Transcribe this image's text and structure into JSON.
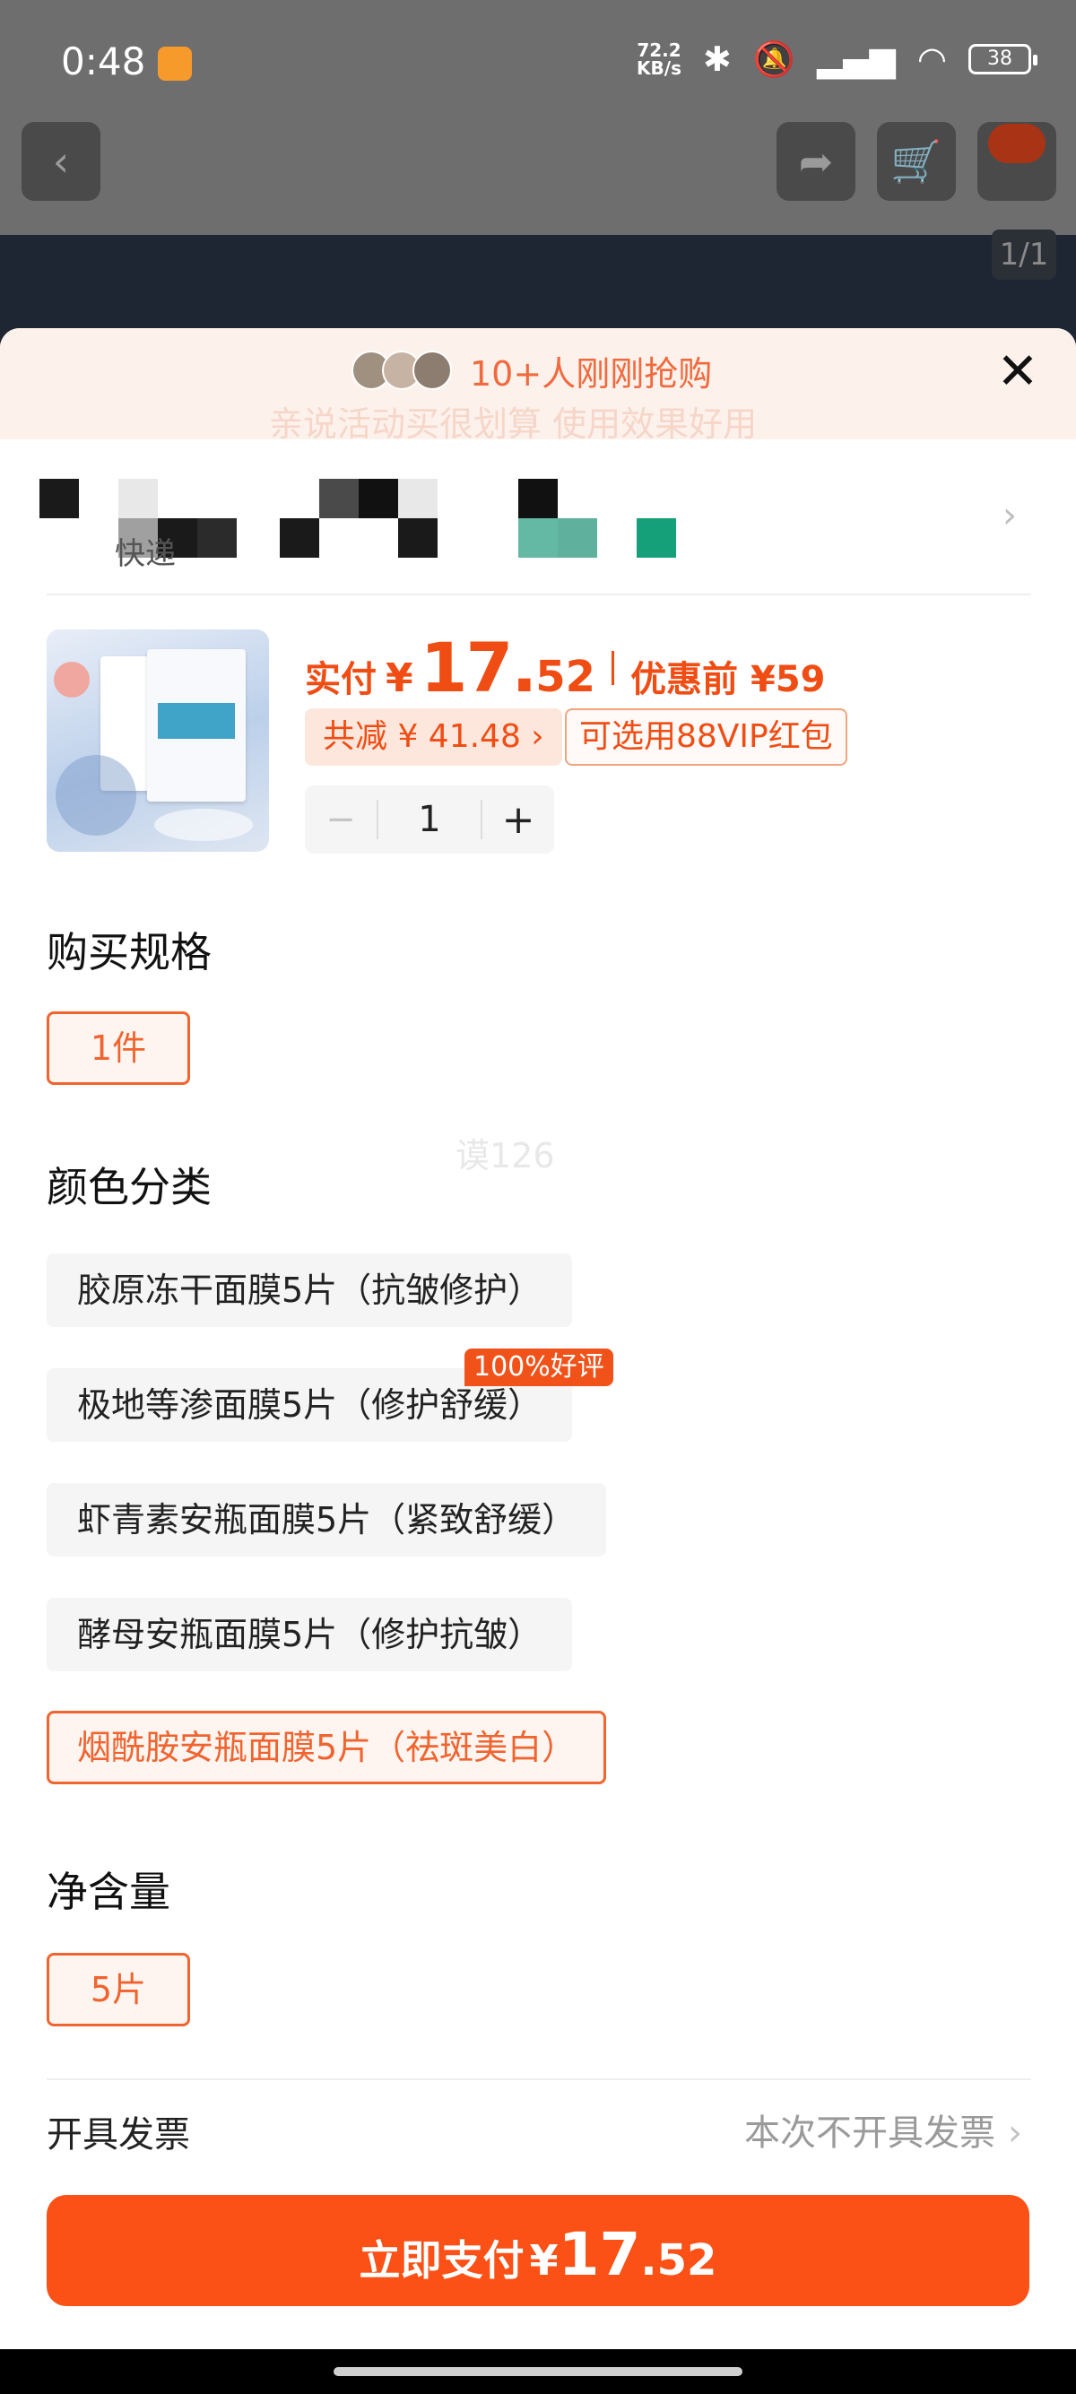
{
  "status_bar": {
    "time": "0:48",
    "net_speed_top": "72.2",
    "net_speed_unit": "KB/s",
    "battery": "38"
  },
  "page": {
    "image_counter": "1/1"
  },
  "banner": {
    "text": "10+人刚刚抢购",
    "ghost_text": "亲说活动买很划算 使用效果好用"
  },
  "address": {
    "tail_text": "快递"
  },
  "product": {
    "price_label": "实付",
    "currency": "¥",
    "price_int": "17.",
    "price_dec": "52",
    "price_before": "优惠前 ¥59",
    "discount_chip": "共减 ¥ 41.48 ›",
    "vip_chip": "可选用88VIP红包",
    "quantity": "1",
    "minus": "−",
    "plus": "+"
  },
  "spec": {
    "title": "购买规格",
    "options": [
      "1件"
    ]
  },
  "watermark": "谟126",
  "color": {
    "title": "颜色分类",
    "options": [
      "胶原冻干面膜5片（抗皱修护）",
      "极地等渗面膜5片（修护舒缓）",
      "虾青素安瓶面膜5片（紧致舒缓）",
      "酵母安瓶面膜5片（修护抗皱）",
      "烟酰胺安瓶面膜5片（祛斑美白）"
    ],
    "tag": "100%好评",
    "selected_index": 4
  },
  "net": {
    "title": "净含量",
    "options": [
      "5片"
    ]
  },
  "invoice": {
    "label": "开具发票",
    "value": "本次不开具发票",
    "chevron": "›"
  },
  "pay": {
    "label": "立即支付",
    "currency": "¥",
    "int": "17",
    "dec": ".52"
  },
  "colors": {
    "accent": "#fb5016",
    "accent_text": "#f04d14",
    "sheet_bg": "#ffffff",
    "overlay": "#6e6e6e"
  }
}
